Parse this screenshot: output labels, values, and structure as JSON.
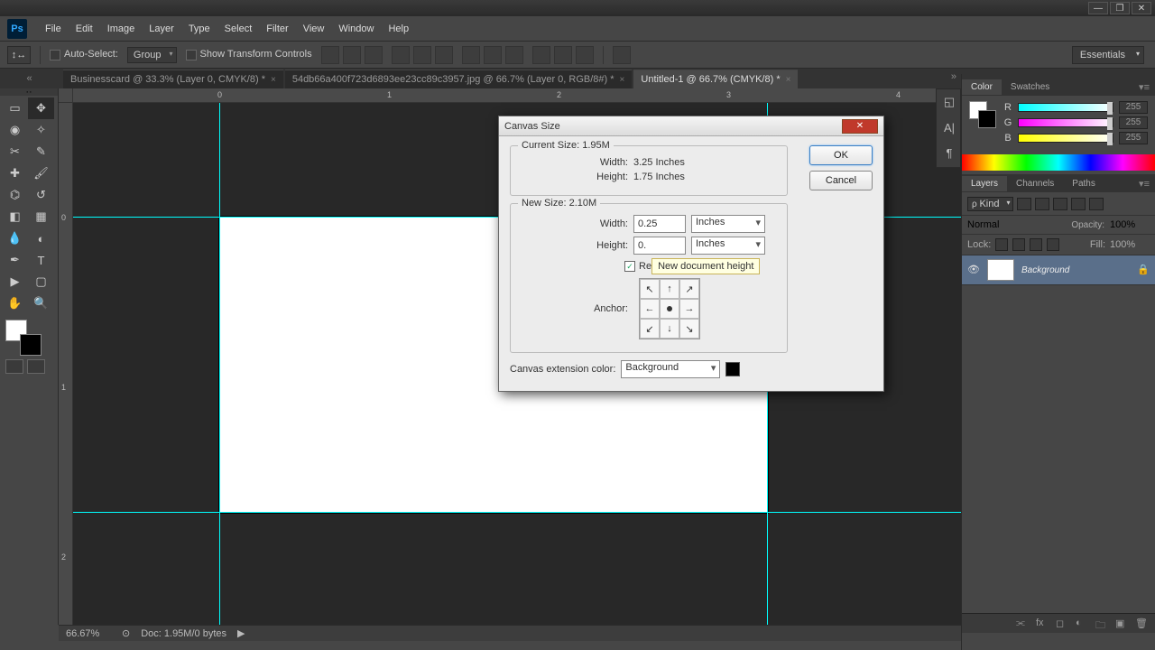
{
  "menubar": {
    "items": [
      "File",
      "Edit",
      "Image",
      "Layer",
      "Type",
      "Select",
      "Filter",
      "View",
      "Window",
      "Help"
    ]
  },
  "optbar": {
    "auto_select": "Auto-Select:",
    "auto_select_mode": "Group",
    "show_transform": "Show Transform Controls",
    "workspace": "Essentials"
  },
  "tabs": [
    {
      "label": "Businesscard @ 33.3% (Layer 0, CMYK/8) *",
      "active": false
    },
    {
      "label": "54db66a400f723d6893ee23cc89c3957.jpg @ 66.7% (Layer 0, RGB/8#) *",
      "active": false
    },
    {
      "label": "Untitled-1 @ 66.7% (CMYK/8) *",
      "active": true
    }
  ],
  "dialog": {
    "title": "Canvas Size",
    "current_size_legend": "Current Size: 1.95M",
    "current_width_label": "Width:",
    "current_width_val": "3.25 Inches",
    "current_height_label": "Height:",
    "current_height_val": "1.75 Inches",
    "new_size_legend": "New Size: 2.10M",
    "new_width_label": "Width:",
    "new_width_val": "0.25",
    "new_height_label": "Height:",
    "new_height_val": "0.",
    "unit": "Inches",
    "relative_partial": "Re",
    "anchor_label": "Anchor:",
    "ext_label": "Canvas extension color:",
    "ext_value": "Background",
    "ok": "OK",
    "cancel": "Cancel",
    "tooltip": "New document height"
  },
  "color_panel": {
    "tab1": "Color",
    "tab2": "Swatches",
    "r_label": "R",
    "g_label": "G",
    "b_label": "B",
    "r": "255",
    "g": "255",
    "b": "255"
  },
  "layers_panel": {
    "tab1": "Layers",
    "tab2": "Channels",
    "tab3": "Paths",
    "kind": "Kind",
    "blend": "Normal",
    "opacity_label": "Opacity:",
    "opacity": "100%",
    "lock_label": "Lock:",
    "fill_label": "Fill:",
    "fill": "100%",
    "bg_layer": "Background"
  },
  "status": {
    "zoom": "66.67%",
    "doc": "Doc: 1.95M/0 bytes"
  },
  "ruler": {
    "zero": "0",
    "one": "1",
    "two": "2",
    "three": "3",
    "four": "4"
  }
}
